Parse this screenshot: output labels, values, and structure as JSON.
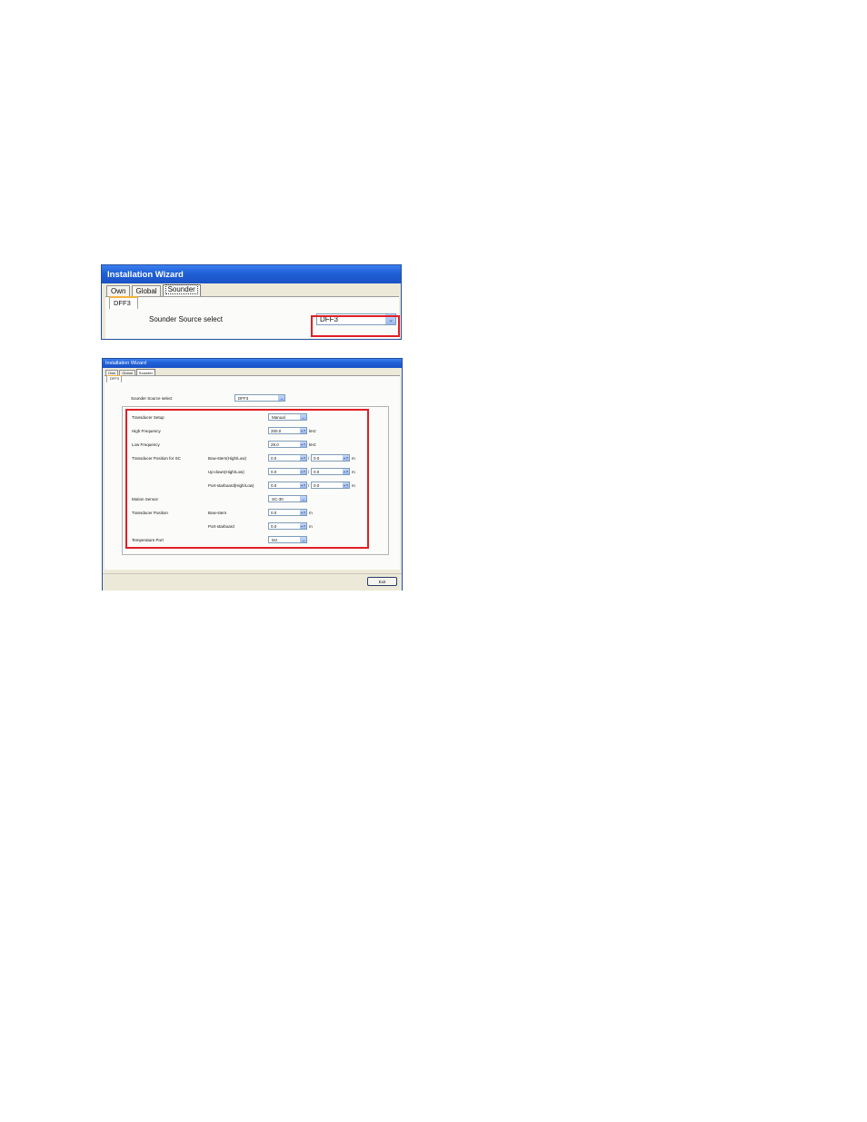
{
  "window_title": "Installation Wizard",
  "tabs": [
    "Own",
    "Global",
    "Sounder"
  ],
  "sub_tab": "DFF3",
  "sounder_source": {
    "label": "Sounder Source select",
    "value": "DFF3"
  },
  "form": {
    "transducer_setup": {
      "label": "Transducer Setup",
      "value": "Manual"
    },
    "high_frequency": {
      "label": "High Frequency",
      "value": "200.0",
      "unit": "kHz"
    },
    "low_frequency": {
      "label": "Low Frequency",
      "value": "28.0",
      "unit": "kHz"
    },
    "transducer_position_sc": {
      "label": "Transducer Position for SC",
      "rows": [
        {
          "label": "Bow-stern(High/Low)",
          "value1": "0.0",
          "value2": "0.0",
          "unit": "m"
        },
        {
          "label": "Up-down(High/Low)",
          "value1": "0.0",
          "value2": "0.0",
          "unit": "m"
        },
        {
          "label": "Port-starboard(High/Low)",
          "value1": "0.0",
          "value2": "0.0",
          "unit": "m"
        }
      ]
    },
    "motion_sensor": {
      "label": "Motion Sensor",
      "value": "SC-30"
    },
    "transducer_position": {
      "label": "Transducer Position",
      "rows": [
        {
          "label": "Bow-stern",
          "value": "0.0",
          "unit": "m"
        },
        {
          "label": "Port-starboard",
          "value": "0.0",
          "unit": "m"
        }
      ]
    },
    "temperature_port": {
      "label": "Temperature Port",
      "value": "MJ"
    }
  },
  "exit_button": "Exit"
}
